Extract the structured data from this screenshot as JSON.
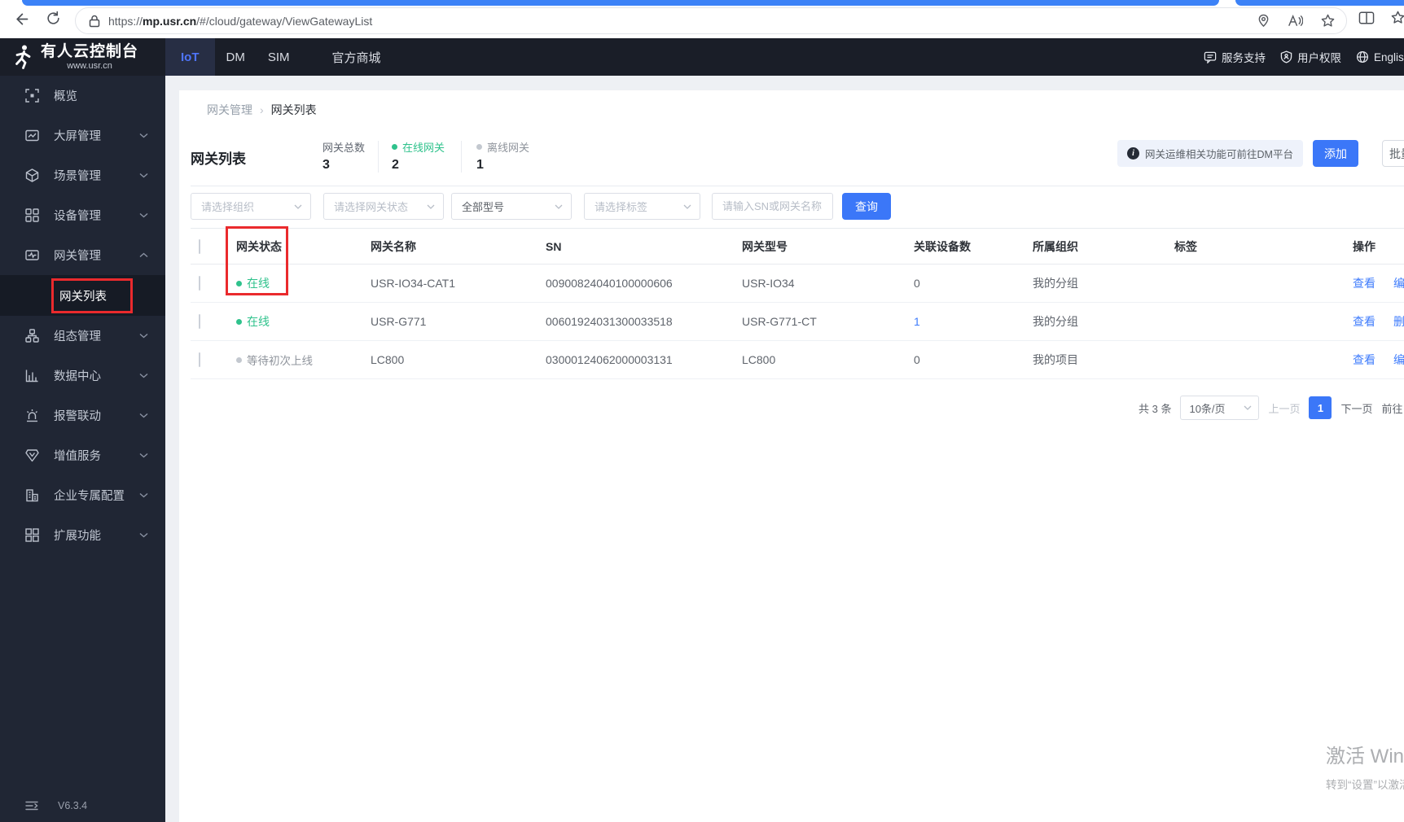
{
  "browser": {
    "url_scheme": "https://",
    "url_host": "mp.usr.cn",
    "url_path": "/#/cloud/gateway/ViewGatewayList"
  },
  "header": {
    "brand": {
      "title": "有人云控制台",
      "subtitle": "www.usr.cn"
    },
    "nav": [
      {
        "label": "IoT"
      },
      {
        "label": "DM"
      },
      {
        "label": "SIM"
      },
      {
        "label": "官方商城"
      }
    ],
    "right": [
      {
        "label": "服务支持"
      },
      {
        "label": "用户权限"
      },
      {
        "label": "English"
      }
    ]
  },
  "sidebar": {
    "items": [
      {
        "label": "概览"
      },
      {
        "label": "大屏管理"
      },
      {
        "label": "场景管理"
      },
      {
        "label": "设备管理"
      },
      {
        "label": "网关管理"
      },
      {
        "label": "组态管理"
      },
      {
        "label": "数据中心"
      },
      {
        "label": "报警联动"
      },
      {
        "label": "增值服务"
      },
      {
        "label": "企业专属配置"
      },
      {
        "label": "扩展功能"
      }
    ],
    "submenu": {
      "label": "网关列表"
    },
    "version": "V6.3.4"
  },
  "breadcrumb": {
    "parent": "网关管理",
    "sep": "›",
    "current": "网关列表"
  },
  "page": {
    "title": "网关列表",
    "stats": [
      {
        "label": "网关总数",
        "value": "3"
      },
      {
        "label": "在线网关",
        "value": "2"
      },
      {
        "label": "离线网关",
        "value": "1"
      }
    ],
    "notice": "网关运维相关功能可前往DM平台",
    "add_button": "添加",
    "batch_button": "批量",
    "filters": {
      "org_placeholder": "请选择组织",
      "status_placeholder": "请选择网关状态",
      "model_value": "全部型号",
      "tag_placeholder": "请选择标签",
      "search_placeholder": "请输入SN或网关名称",
      "query_button": "查询"
    }
  },
  "table": {
    "columns": [
      "网关状态",
      "网关名称",
      "SN",
      "网关型号",
      "关联设备数",
      "所属组织",
      "标签",
      "操作"
    ],
    "rows": [
      {
        "status": "在线",
        "name": "USR-IO34-CAT1",
        "sn": "00900824040100000606",
        "model": "USR-IO34",
        "devices": "0",
        "org": "我的分组",
        "tag": "",
        "action1": "查看",
        "action2": "编辑"
      },
      {
        "status": "在线",
        "name": "USR-G771",
        "sn": "00601924031300033518",
        "model": "USR-G771-CT",
        "devices": "1",
        "org": "我的分组",
        "tag": "",
        "action1": "查看",
        "action2": "删除"
      },
      {
        "status": "等待初次上线",
        "name": "LC800",
        "sn": "03000124062000003131",
        "model": "LC800",
        "devices": "0",
        "org": "我的项目",
        "tag": "",
        "action1": "查看",
        "action2": "编辑"
      }
    ]
  },
  "pagination": {
    "total": "共 3 条",
    "page_size": "10条/页",
    "prev": "上一页",
    "current": "1",
    "next": "下一页",
    "jump": "前往"
  },
  "watermark": {
    "line1": "激活 Windows",
    "line2": "转到“设置”以激活 Windows。"
  },
  "icons": {
    "back-icon": "←",
    "refresh-icon": "⟳",
    "lock-icon": "padlock",
    "location-icon": "pin",
    "read-aloud-icon": "A)",
    "favorite-star-icon": "☆",
    "split-screen-icon": "[|]",
    "chat-icon": "speech-bubble",
    "shield-icon": "shield",
    "globe-icon": "globe",
    "info-icon": "ⓘ",
    "chevron-down-icon": "˅",
    "chevron-up-icon": "˄",
    "status-dot-online": "●",
    "status-dot-offline": "●",
    "checkbox": "☐"
  },
  "colors": {
    "accent_blue": "#3b77f8",
    "online_green": "#2fc28c",
    "offline_grey": "#c3c8cf",
    "highlight_red": "#ea2a2d",
    "header_dark": "#1a1e28",
    "sidebar_dark": "#202634"
  }
}
